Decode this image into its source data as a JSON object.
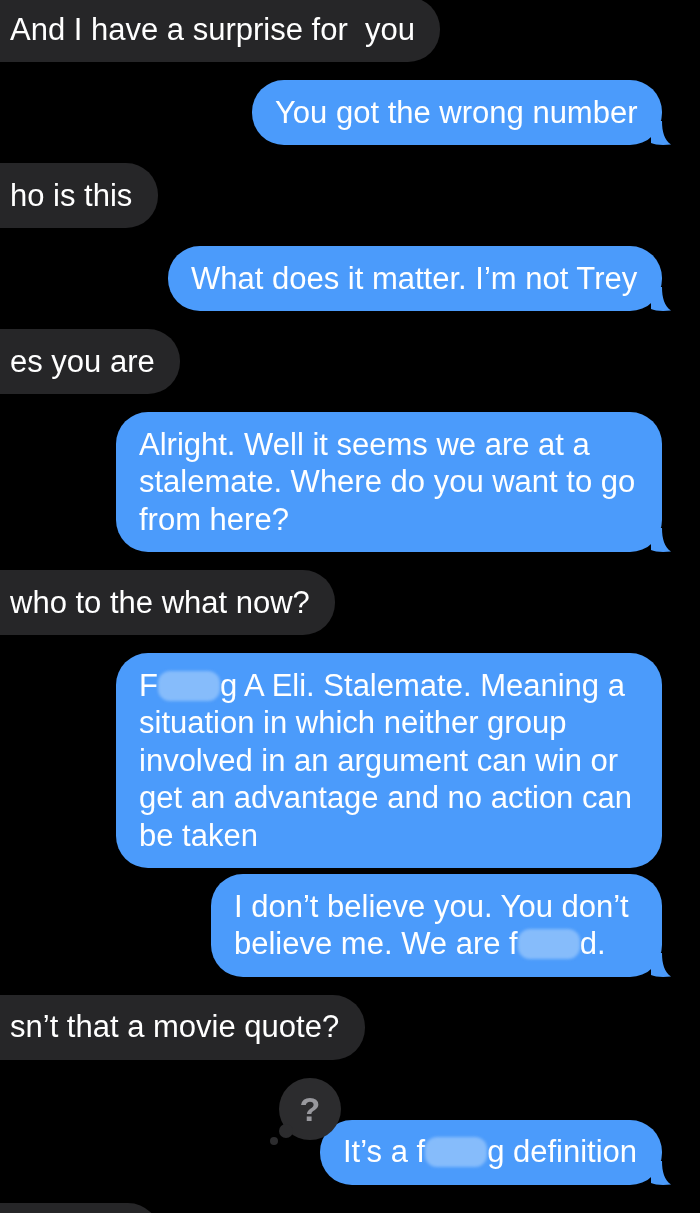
{
  "messages": [
    {
      "kind": "received",
      "text": "And I have a surprise for  you"
    },
    {
      "kind": "sent",
      "tail": true,
      "text": "You got the wrong number"
    },
    {
      "kind": "received",
      "text": "ho is this"
    },
    {
      "kind": "sent",
      "tail": true,
      "text": "What does it matter. I’m not Trey"
    },
    {
      "kind": "received",
      "text": "es you are"
    },
    {
      "kind": "sent",
      "tail": true,
      "text": "Alright. Well it seems we are at a stalemate. Where do you want to go from here?"
    },
    {
      "kind": "received",
      "text": "who to the what now?"
    },
    {
      "kind": "sent",
      "tail": false,
      "parts": [
        {
          "kind": "text",
          "text": "F"
        },
        {
          "kind": "blur"
        },
        {
          "kind": "text",
          "text": "g A Eli. Stalemate. Meaning a situation in which neither group involved in an argument can win or get an advantage and no action can be taken"
        }
      ]
    },
    {
      "kind": "sent",
      "tail": true,
      "parts": [
        {
          "kind": "text",
          "text": "I don’t believe you. You don’t believe me. We are f"
        },
        {
          "kind": "blur"
        },
        {
          "kind": "text",
          "text": "d."
        }
      ]
    },
    {
      "kind": "received",
      "text": "sn’t that a movie quote?"
    },
    {
      "kind": "sent",
      "tail": true,
      "reaction": "?",
      "parts": [
        {
          "kind": "text",
          "text": "It’s a f"
        },
        {
          "kind": "blur"
        },
        {
          "kind": "text",
          "text": "g definition"
        }
      ]
    },
    {
      "kind": "received"
    }
  ]
}
